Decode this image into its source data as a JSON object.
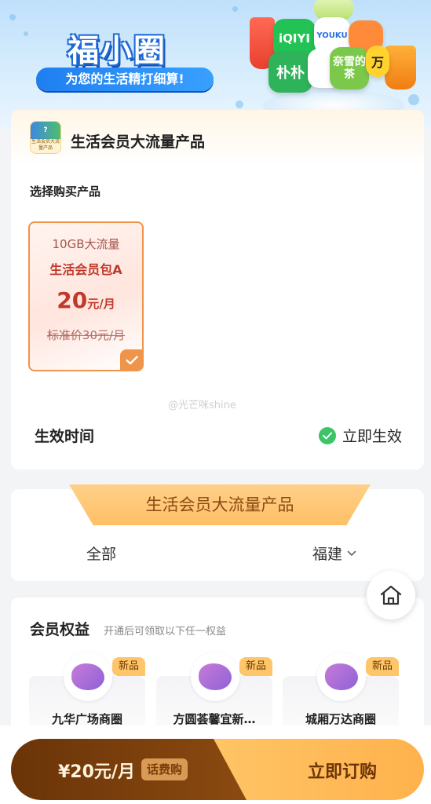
{
  "banner": {
    "brand": "福小圈",
    "slogan": "为您的生活精打细算!",
    "app_tiles": [
      "iQIYI",
      "YOUKU",
      "朴朴",
      "奈雪的茶",
      "万"
    ]
  },
  "product_card": {
    "logo_label": "生活会员大流量产品",
    "title": "生活会员大流量产品",
    "section_label": "选择购买产品",
    "product": {
      "data": "10GB大流量",
      "name": "生活会员包A",
      "price_value": "20",
      "price_unit": "元/月",
      "original_price": "标准价30元/月",
      "selected": true
    },
    "watermark": "@光芒咪shine",
    "effective_label": "生效时间",
    "effective_value": "立即生效"
  },
  "filter_card": {
    "ribbon": "生活会员大流量产品",
    "all_label": "全部",
    "region_label": "福建"
  },
  "benefits": {
    "title": "会员权益",
    "subtitle": "开通后可领取以下任一权益",
    "items": [
      {
        "badge": "新品",
        "name": "九华广场商圈"
      },
      {
        "badge": "新品",
        "name": "方圆荟馨宜新…"
      },
      {
        "badge": "新品",
        "name": "城厢万达商圈"
      }
    ]
  },
  "buy_bar": {
    "price": "¥20元/月",
    "tag": "话费购",
    "cta": "立即订购"
  },
  "colors": {
    "accent_orange": "#f0944a",
    "price_red": "#c0392b",
    "brand_blue": "#1f7ff0",
    "success_green": "#3cc468",
    "cta_brown": "#6a3408"
  }
}
